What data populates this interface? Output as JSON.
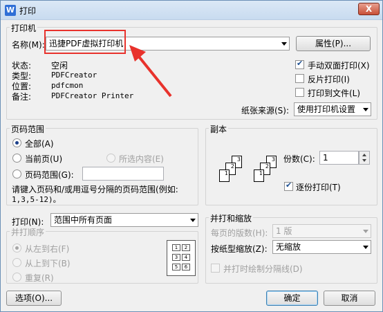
{
  "window": {
    "title": "打印",
    "close_label": "X",
    "app_icon": "W"
  },
  "printer": {
    "group_title": "打印机",
    "name_label": "名称(M):",
    "name_value": "迅捷PDF虚拟打印机",
    "properties_button": "属性(P)...",
    "status_label": "状态:",
    "status_value": "空闲",
    "type_label": "类型:",
    "type_value": "PDFCreator",
    "where_label": "位置:",
    "where_value": "pdfcmon",
    "comment_label": "备注:",
    "comment_value": "PDFCreator Printer",
    "duplex_label": "手动双面打印(X)",
    "duplex_checked": true,
    "reverse_label": "反片打印(I)",
    "reverse_checked": false,
    "to_file_label": "打印到文件(L)",
    "to_file_checked": false,
    "paper_source_label": "纸张来源(S):",
    "paper_source_value": "使用打印机设置"
  },
  "page_range": {
    "group_title": "页码范围",
    "all_label": "全部(A)",
    "current_label": "当前页(U)",
    "selection_label": "所选内容(E)",
    "pages_label": "页码范围(G):",
    "pages_value": "",
    "hint": "请键入页码和/或用逗号分隔的页码范围(例如:",
    "hint_example": "1,3,5-12)。",
    "selected": "all"
  },
  "copies": {
    "group_title": "副本",
    "count_label": "份数(C):",
    "count_value": "1",
    "collate_label": "逐份打印(T)",
    "collate_checked": true
  },
  "print_what": {
    "label": "打印(N):",
    "value": "范围中所有页面"
  },
  "order": {
    "group_title": "并打顺序",
    "lr_label": "从左到右(F)",
    "tb_label": "从上到下(B)",
    "repeat_label": "重复(R)",
    "selected": "lr"
  },
  "zoom": {
    "group_title": "并打和缩放",
    "pages_per_sheet_label": "每页的版数(H):",
    "pages_per_sheet_value": "1 版",
    "scale_label": "按纸型缩放(Z):",
    "scale_value": "无缩放",
    "divider_label": "并打时绘制分隔线(D)",
    "divider_checked": false
  },
  "footer": {
    "options_button": "选项(O)...",
    "ok_button": "确定",
    "cancel_button": "取消"
  },
  "annotation": {
    "color": "#e8322c"
  }
}
